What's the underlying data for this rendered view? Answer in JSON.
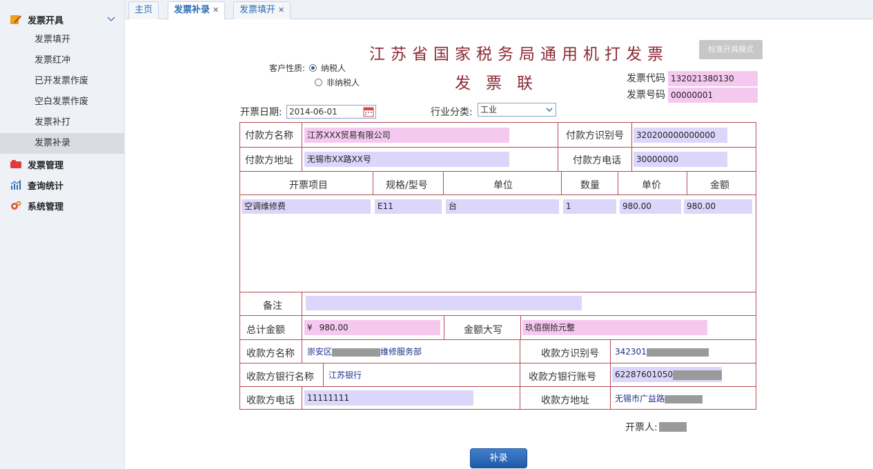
{
  "sidebar": {
    "groups": [
      {
        "label": "发票开具",
        "icon": "pencil-note-icon",
        "color": "#f0a020"
      },
      {
        "label": "发票管理",
        "icon": "folder-icon",
        "color": "#e03a3a"
      },
      {
        "label": "查询统计",
        "icon": "chart-icon",
        "color": "#2a6db3"
      },
      {
        "label": "系统管理",
        "icon": "gear-icon",
        "color": "#e05a3a"
      }
    ],
    "items": [
      "发票填开",
      "发票红冲",
      "已开发票作废",
      "空白发票作废",
      "发票补打",
      "发票补录"
    ],
    "active_item": "发票补录"
  },
  "tabs": [
    {
      "label": "主页",
      "closable": false
    },
    {
      "label": "发票补录",
      "closable": true,
      "active": true
    },
    {
      "label": "发票填开",
      "closable": true
    }
  ],
  "form": {
    "title": "江苏省国家税务局通用机打发票",
    "subtitle": "发票联",
    "mode_button": "标准开具模式",
    "customer_type_label": "客户性质:",
    "customer_type_options": [
      "纳税人",
      "非纳税人"
    ],
    "customer_type_selected": "纳税人",
    "invoice_code_label": "发票代码",
    "invoice_code": "132021380130",
    "invoice_number_label": "发票号码",
    "invoice_number": "00000001",
    "date_label": "开票日期:",
    "date": "2014-06-01",
    "industry_label": "行业分类:",
    "industry": "工业",
    "payer_name_label": "付款方名称",
    "payer_name": "江苏XXX贸易有限公司",
    "payer_id_label": "付款方识别号",
    "payer_id": "320200000000000",
    "payer_address_label": "付款方地址",
    "payer_address": "无锡市XX路XX号",
    "payer_phone_label": "付款方电话",
    "payer_phone": "30000000",
    "columns": [
      "开票项目",
      "规格/型号",
      "单位",
      "数量",
      "单价",
      "金额"
    ],
    "rows": [
      {
        "item": "空调维修费",
        "spec": "E11",
        "unit": "台",
        "qty": "1",
        "price": "980.00",
        "amount": "980.00"
      }
    ],
    "remark_label": "备注",
    "remark": "",
    "total_label": "总计金额",
    "currency_symbol": "¥",
    "total": "980.00",
    "total_words_label": "金额大写",
    "total_words": "玖佰捌拾元整",
    "payee_name_label": "收款方名称",
    "payee_name_prefix": "崇安区",
    "payee_name_suffix": "维修服务部",
    "payee_id_label": "收款方识别号",
    "payee_id_prefix": "342301",
    "payee_bank_label": "收款方银行名称",
    "payee_bank": "江苏银行",
    "payee_account_label": "收款方银行账号",
    "payee_account_prefix": "62287601050",
    "payee_phone_label": "收款方电话",
    "payee_phone": "11111111",
    "payee_address_label": "收款方地址",
    "payee_address_prefix": "无锡市广益路",
    "issuer_label": "开票人:",
    "submit_label": "补录"
  },
  "colors": {
    "accent": "#2a6db3",
    "title": "#8b2a35",
    "border": "#b24a55",
    "pink_field": "#f5c9ef",
    "lavender_field": "#dcd6fb"
  }
}
